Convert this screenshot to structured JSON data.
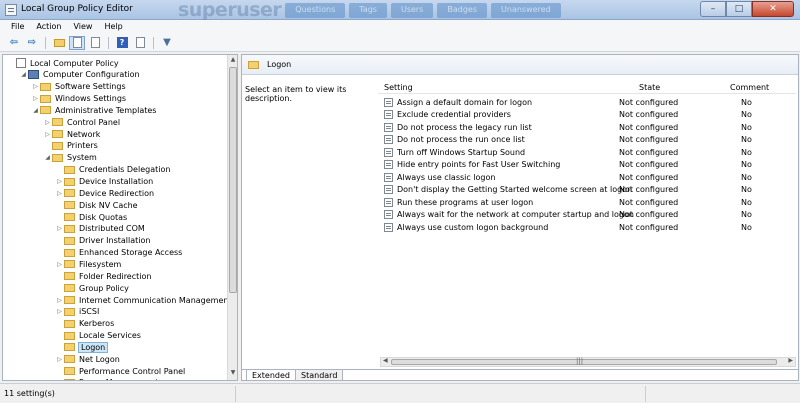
{
  "window": {
    "title": "Local Group Policy Editor",
    "controls": {
      "minimize": "–",
      "maximize": "□",
      "close": "✕"
    }
  },
  "watermark": {
    "logo": "superuser",
    "tabs": [
      "Questions",
      "Tags",
      "Users",
      "Badges",
      "Unanswered"
    ]
  },
  "menu": [
    "File",
    "Action",
    "View",
    "Help"
  ],
  "toolbar": {
    "icons": [
      "arrow-left-icon",
      "arrow-right-icon",
      "folder-up-icon",
      "show-hide-tree-icon",
      "export-list-icon",
      "help-icon",
      "properties-icon",
      "filter-icon"
    ]
  },
  "tree": [
    {
      "label": "Local Computer Policy",
      "level": 0,
      "expander": "",
      "icon": "policy"
    },
    {
      "label": "Computer Configuration",
      "level": 1,
      "expander": "◢",
      "icon": "computer"
    },
    {
      "label": "Software Settings",
      "level": 2,
      "expander": "▷",
      "icon": "folder"
    },
    {
      "label": "Windows Settings",
      "level": 2,
      "expander": "▷",
      "icon": "folder"
    },
    {
      "label": "Administrative Templates",
      "level": 2,
      "expander": "◢",
      "icon": "folder"
    },
    {
      "label": "Control Panel",
      "level": 3,
      "expander": "▷",
      "icon": "folder"
    },
    {
      "label": "Network",
      "level": 3,
      "expander": "▷",
      "icon": "folder"
    },
    {
      "label": "Printers",
      "level": 3,
      "expander": "",
      "icon": "folder"
    },
    {
      "label": "System",
      "level": 3,
      "expander": "◢",
      "icon": "folder"
    },
    {
      "label": "Credentials Delegation",
      "level": 4,
      "expander": "",
      "icon": "folder"
    },
    {
      "label": "Device Installation",
      "level": 4,
      "expander": "▷",
      "icon": "folder"
    },
    {
      "label": "Device Redirection",
      "level": 4,
      "expander": "▷",
      "icon": "folder"
    },
    {
      "label": "Disk NV Cache",
      "level": 4,
      "expander": "",
      "icon": "folder"
    },
    {
      "label": "Disk Quotas",
      "level": 4,
      "expander": "",
      "icon": "folder"
    },
    {
      "label": "Distributed COM",
      "level": 4,
      "expander": "▷",
      "icon": "folder"
    },
    {
      "label": "Driver Installation",
      "level": 4,
      "expander": "",
      "icon": "folder"
    },
    {
      "label": "Enhanced Storage Access",
      "level": 4,
      "expander": "",
      "icon": "folder"
    },
    {
      "label": "Filesystem",
      "level": 4,
      "expander": "▷",
      "icon": "folder"
    },
    {
      "label": "Folder Redirection",
      "level": 4,
      "expander": "",
      "icon": "folder"
    },
    {
      "label": "Group Policy",
      "level": 4,
      "expander": "",
      "icon": "folder"
    },
    {
      "label": "Internet Communication Management",
      "level": 4,
      "expander": "▷",
      "icon": "folder"
    },
    {
      "label": "iSCSI",
      "level": 4,
      "expander": "▷",
      "icon": "folder"
    },
    {
      "label": "Kerberos",
      "level": 4,
      "expander": "",
      "icon": "folder"
    },
    {
      "label": "Locale Services",
      "level": 4,
      "expander": "",
      "icon": "folder"
    },
    {
      "label": "Logon",
      "level": 4,
      "expander": "",
      "icon": "folder",
      "selected": true
    },
    {
      "label": "Net Logon",
      "level": 4,
      "expander": "▷",
      "icon": "folder"
    },
    {
      "label": "Performance Control Panel",
      "level": 4,
      "expander": "",
      "icon": "folder"
    },
    {
      "label": "Power Management",
      "level": 4,
      "expander": "▷",
      "icon": "folder"
    }
  ],
  "right_pane": {
    "header": "Logon",
    "description": "Select an item to view its description.",
    "columns": [
      "Setting",
      "State",
      "Comment"
    ],
    "rows": [
      {
        "setting": "Assign a default domain for logon",
        "state": "Not configured",
        "comment": "No"
      },
      {
        "setting": "Exclude credential providers",
        "state": "Not configured",
        "comment": "No"
      },
      {
        "setting": "Do not process the legacy run list",
        "state": "Not configured",
        "comment": "No"
      },
      {
        "setting": "Do not process the run once list",
        "state": "Not configured",
        "comment": "No"
      },
      {
        "setting": "Turn off Windows Startup Sound",
        "state": "Not configured",
        "comment": "No"
      },
      {
        "setting": "Hide entry points for Fast User Switching",
        "state": "Not configured",
        "comment": "No"
      },
      {
        "setting": "Always use classic logon",
        "state": "Not configured",
        "comment": "No"
      },
      {
        "setting": "Don't display the Getting Started welcome screen at logon",
        "state": "Not configured",
        "comment": "No"
      },
      {
        "setting": "Run these programs at user logon",
        "state": "Not configured",
        "comment": "No"
      },
      {
        "setting": "Always wait for the network at computer startup and logon",
        "state": "Not configured",
        "comment": "No"
      },
      {
        "setting": "Always use custom logon background",
        "state": "Not configured",
        "comment": "No"
      }
    ],
    "tabs": [
      "Extended",
      "Standard"
    ],
    "active_tab": "Extended"
  },
  "status": {
    "text": "11 setting(s)"
  }
}
